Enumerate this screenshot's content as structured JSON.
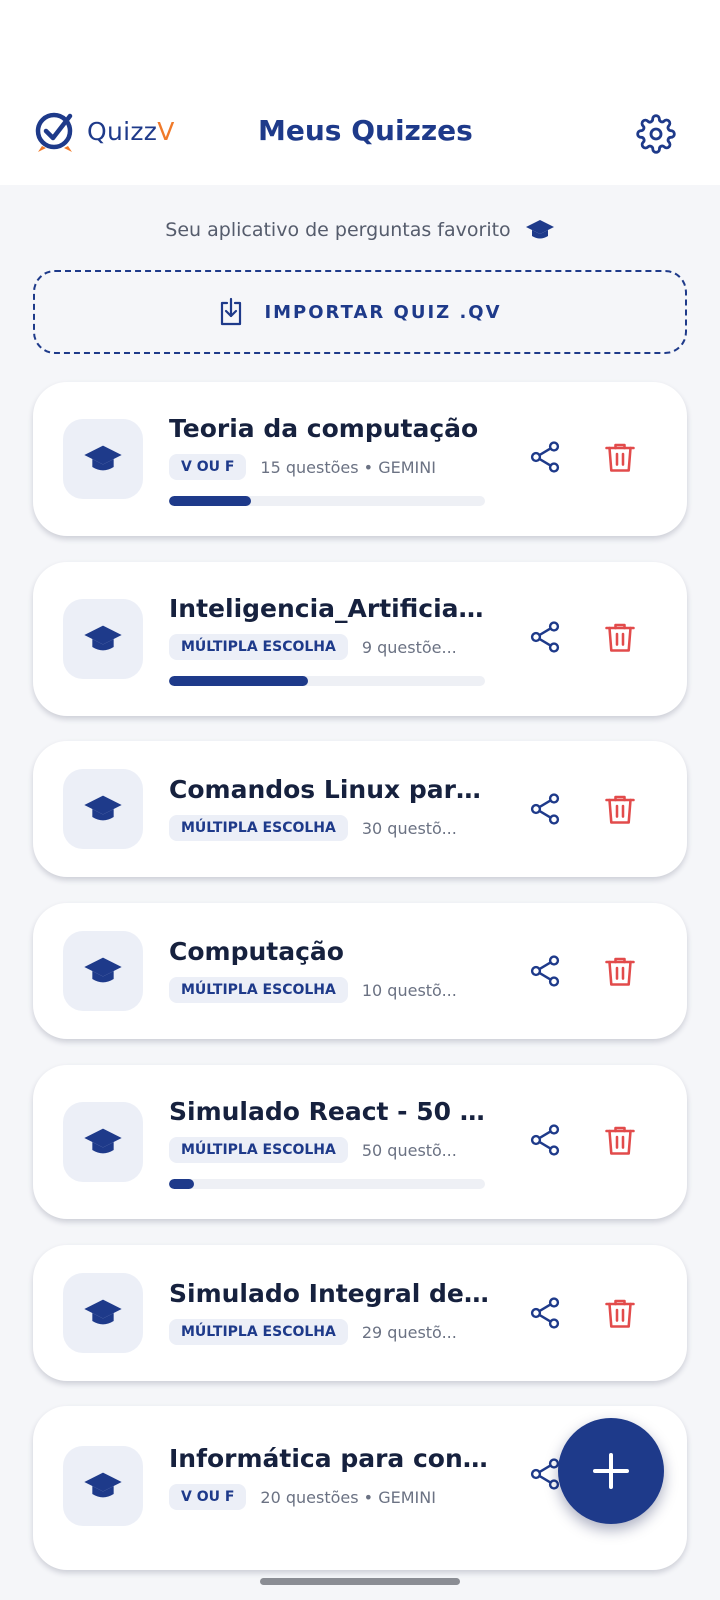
{
  "app": {
    "brand_quizz": "Quizz",
    "brand_v": "V",
    "title": "Meus Quizzes",
    "subtitle": "Seu aplicativo de perguntas favorito",
    "import_label": "IMPORTAR QUIZ .QV",
    "accent_color": "#1e3a8a",
    "brand_orange": "#f07a2a",
    "delete_color": "#e24b4b"
  },
  "quizzes": [
    {
      "title": "Teoria da computação",
      "tag": "V OU F",
      "meta": "15 questões • GEMINI",
      "progress": 0.26
    },
    {
      "title": "Inteligencia_Artificial -...",
      "tag": "MÚLTIPLA ESCOLHA",
      "meta": "9 questõe...",
      "progress": 0.44
    },
    {
      "title": "Comandos Linux para ...",
      "tag": "MÚLTIPLA ESCOLHA",
      "meta": "30 questõ...",
      "progress": null
    },
    {
      "title": "Computação",
      "tag": "MÚLTIPLA ESCOLHA",
      "meta": "10 questõ...",
      "progress": null
    },
    {
      "title": "Simulado React - 50 Q...",
      "tag": "MÚLTIPLA ESCOLHA",
      "meta": "50 questõ...",
      "progress": 0.08
    },
    {
      "title": "Simulado Integral de A...",
      "tag": "MÚLTIPLA ESCOLHA",
      "meta": "29 questõ...",
      "progress": null
    },
    {
      "title": "Informática para conc...",
      "tag": "V OU F",
      "meta": "20 questões • GEMINI",
      "progress": null
    }
  ]
}
